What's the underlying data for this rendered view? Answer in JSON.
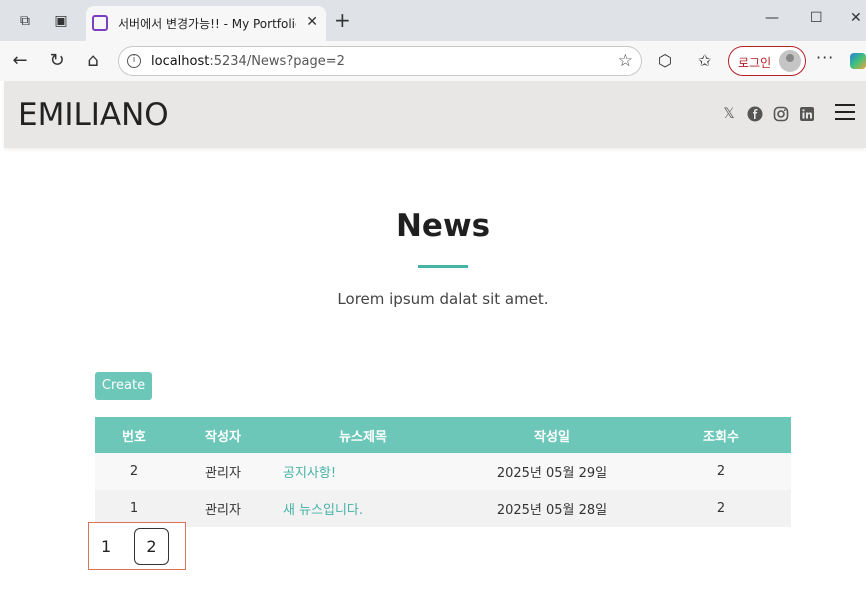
{
  "browser": {
    "tab_title": "서버에서 변경가능!! - My Portfolio",
    "new_tab": "+",
    "url_host": "localhost",
    "url_rest": ":5234/News?page=2",
    "login_label": "로그인",
    "more_label": "···"
  },
  "site": {
    "logo": "EMILIANO",
    "social": [
      "x-icon",
      "facebook-icon",
      "instagram-icon",
      "linkedin-icon"
    ]
  },
  "news": {
    "title": "News",
    "subtitle": "Lorem ipsum dalat sit amet.",
    "create_label": "Create",
    "columns": [
      "번호",
      "작성자",
      "뉴스제목",
      "작성일",
      "조회수"
    ],
    "rows": [
      {
        "num": "2",
        "author": "관리자",
        "title": "공지사항!",
        "date": "2025년 05월 29일",
        "views": "2"
      },
      {
        "num": "1",
        "author": "관리자",
        "title": "새 뉴스입니다.",
        "date": "2025년 05월 28일",
        "views": "2"
      }
    ]
  },
  "pagination": {
    "pages": [
      "1",
      "2"
    ],
    "current": "2"
  },
  "colors": {
    "accent": "#6cc7b9",
    "link": "#45b3a5",
    "header_bg": "#e8e7e6",
    "pager_border": "#d9735a"
  }
}
